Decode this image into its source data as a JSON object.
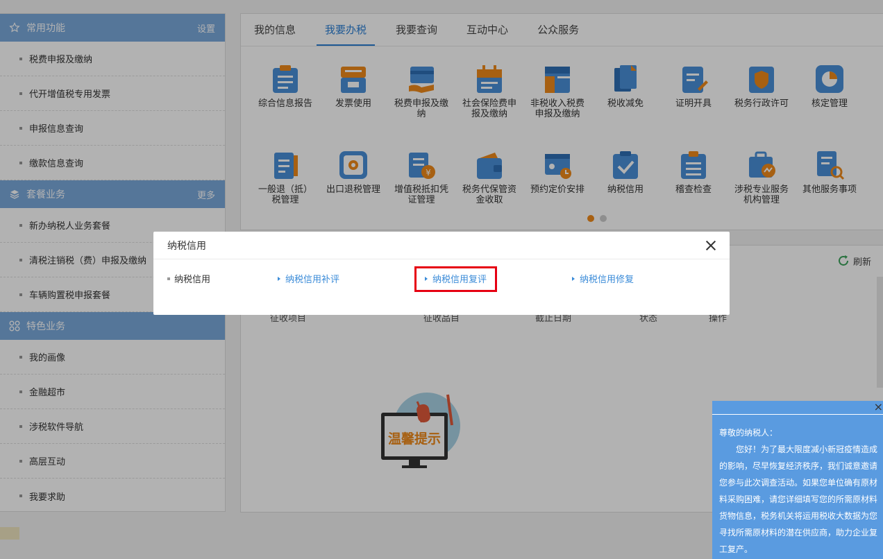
{
  "sidebar": {
    "sections": [
      {
        "title": "常用功能",
        "action": "设置",
        "icon": "star-icon",
        "items": [
          "税费申报及缴纳",
          "代开增值税专用发票",
          "申报信息查询",
          "缴款信息查询"
        ]
      },
      {
        "title": "套餐业务",
        "action": "更多",
        "icon": "layers-icon",
        "items": [
          "新办纳税人业务套餐",
          "清税注销税（费）申报及缴纳",
          "车辆购置税申报套餐"
        ]
      },
      {
        "title": "特色业务",
        "action": "",
        "icon": "grid-icon",
        "items": [
          "我的画像",
          "金融超市",
          "涉税软件导航",
          "高层互动",
          "我要求助"
        ]
      }
    ]
  },
  "main": {
    "tabs": [
      "我的信息",
      "我要办税",
      "我要查询",
      "互动中心",
      "公众服务"
    ],
    "active_tab": "我要办税",
    "grid_row1": [
      "综合信息报告",
      "发票使用",
      "税费申报及缴纳",
      "社会保险费申报及缴纳",
      "非税收入税费申报及缴纳",
      "税收减免",
      "证明开具",
      "税务行政许可",
      "核定管理"
    ],
    "grid_row2": [
      "一般退（抵）税管理",
      "出口退税管理",
      "增值税抵扣凭证管理",
      "税务代保管资金收取",
      "预约定价安排",
      "纳税信用",
      "稽查检查",
      "涉税专业服务机构管理",
      "其他服务事项"
    ]
  },
  "lower": {
    "refresh_label": "刷新",
    "headers": [
      "征收项目",
      "征收品目",
      "截止日期",
      "状态",
      "操作"
    ],
    "notice_image_text": "温馨提示"
  },
  "tip": {
    "close": "×",
    "greeting": "尊敬的纳税人：",
    "body": "您好！为了最大限度减小新冠疫情造成的影响，尽早恢复经济秩序，我们诚意邀请您参与此次调查活动。如果您单位确有原材料采购困难，请您详细填写您的所需原材料货物信息，税务机关将运用税收大数据为您寻找所需原材料的潜在供应商，助力企业复工复产。"
  },
  "dialog": {
    "title": "纳税信用",
    "category": "纳税信用",
    "links": [
      "纳税信用补评",
      "纳税信用复评",
      "纳税信用修复"
    ]
  },
  "colors": {
    "accent": "#2a7fd4",
    "sidebar_head": "#7aa9dc",
    "highlight": "#e60012"
  }
}
